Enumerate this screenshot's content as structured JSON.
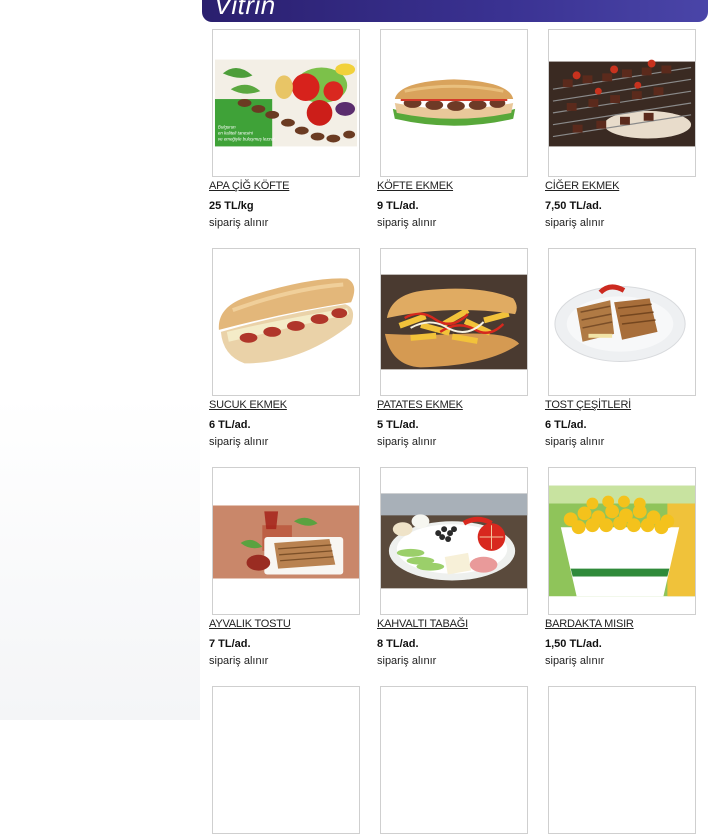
{
  "header": {
    "title": "Vitrin"
  },
  "products": [
    {
      "name": "APA ÇİĞ KÖFTE",
      "price": "25 TL/kg",
      "note": "sipariş alınır",
      "image_text": "Bulgurun en kaliteli tanesini ve emeğiyle buluşmuş lezzet"
    },
    {
      "name": "KÖFTE EKMEK",
      "price": "9 TL/ad.",
      "note": "sipariş alınır"
    },
    {
      "name": "CİĞER EKMEK",
      "price": "7,50 TL/ad.",
      "note": "sipariş alınır"
    },
    {
      "name": "SUCUK EKMEK",
      "price": "6 TL/ad.",
      "note": "sipariş alınır"
    },
    {
      "name": "PATATES EKMEK",
      "price": "5 TL/ad.",
      "note": "sipariş alınır"
    },
    {
      "name": "TOST ÇEŞİTLERİ",
      "price": "6 TL/ad.",
      "note": "sipariş alınır"
    },
    {
      "name": "AYVALIK TOSTU",
      "price": "7 TL/ad.",
      "note": "sipariş alınır"
    },
    {
      "name": "KAHVALTI TABAĞI",
      "price": "8 TL/ad.",
      "note": "sipariş alınır"
    },
    {
      "name": "BARDAKTA MISIR",
      "price": "1,50 TL/ad.",
      "note": "sipariş alınır"
    }
  ]
}
